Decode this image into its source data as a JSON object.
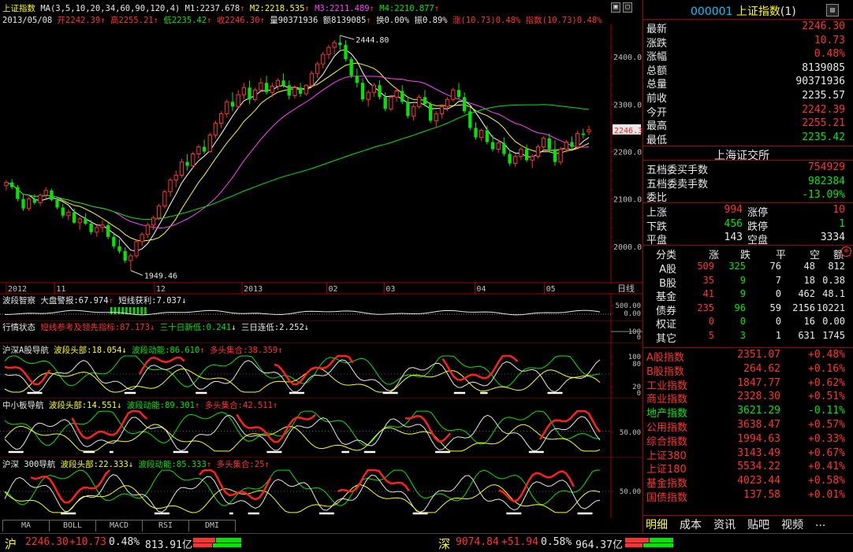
{
  "colors": {
    "up": "#ff3232",
    "down": "#00e600",
    "ma5": "#ffffff",
    "ma10": "#ffff00",
    "ma20": "#ff40ff",
    "ma60": "#00e600",
    "bg": "#000000",
    "grid": "#a00000"
  },
  "header": {
    "line1_name": "上证指数",
    "line1_ma": "MA(3,5,10,20,34,60,90,120,4)",
    "m1": "M1:2237.678",
    "m1_arrow": "↑",
    "m2": "M2:2218.535",
    "m2_arrow": "↑",
    "m3": "M3:2211.489",
    "m3_arrow": "↑",
    "m4": "M4:2210.877",
    "m4_arrow": "↑",
    "date": "2013/05/08",
    "open": "开2242.39",
    "open_arrow": "↑",
    "high": "高2255.21",
    "high_arrow": "↑",
    "low": "低2235.42",
    "low_arrow": "↑",
    "close": "收2246.30",
    "close_arrow": "↑",
    "volume": "量90371936",
    "amount": "额8139085",
    "amount_arrow": "↑",
    "turnover": "换0.00%",
    "amplitude": "振0.89%",
    "change": "涨(10.73)0.48%",
    "index_change": "指数(10.73)0.48%"
  },
  "right_panel": {
    "code": "000001",
    "name": "上证指数",
    "suffix": "(1)",
    "quote": [
      {
        "label": "最新",
        "value": "2246.30",
        "color": "r"
      },
      {
        "label": "涨跌",
        "value": "10.73",
        "color": "r"
      },
      {
        "label": "涨幅",
        "value": "0.48%",
        "color": "r"
      },
      {
        "label": "总额",
        "value": "8139085",
        "color": "w"
      },
      {
        "label": "总量",
        "value": "90371936",
        "color": "w"
      },
      {
        "label": "前收",
        "value": "2235.57",
        "color": "w"
      },
      {
        "label": "今开",
        "value": "2242.39",
        "color": "r"
      },
      {
        "label": "最高",
        "value": "2255.21",
        "color": "r"
      },
      {
        "label": "最低",
        "value": "2235.42",
        "color": "g"
      }
    ],
    "exchange": "上海证交所",
    "orders": [
      {
        "label": "五档委买手数",
        "value": "754929",
        "color": "r"
      },
      {
        "label": "五档委卖手数",
        "value": "982384",
        "color": "g"
      },
      {
        "label": "委比",
        "value": "-13.09%",
        "color": "g"
      }
    ],
    "breadth": [
      {
        "l1": "上涨",
        "v1": "994",
        "c1": "r",
        "l2": "涨停",
        "v2": "10",
        "c2": "r"
      },
      {
        "l1": "下跌",
        "v1": "456",
        "c1": "g",
        "l2": "跌停",
        "v2": "1",
        "c2": "g"
      },
      {
        "l1": "平盘",
        "v1": "143",
        "c1": "w",
        "l2": "空盘",
        "v2": "3334",
        "c2": "w"
      }
    ],
    "cat_header": [
      "分类",
      "涨",
      "跌",
      "平",
      "空",
      "额"
    ],
    "categories": [
      {
        "name": "A股",
        "up": "509",
        "down": "325",
        "flat": "76",
        "empty": "48",
        "amt": "812"
      },
      {
        "name": "B股",
        "up": "35",
        "down": "9",
        "flat": "7",
        "empty": "18",
        "amt": "0.38"
      },
      {
        "name": "基金",
        "up": "41",
        "down": "9",
        "flat": "0",
        "empty": "462",
        "amt": "48.1"
      },
      {
        "name": "债券",
        "up": "235",
        "down": "96",
        "flat": "59",
        "empty": "2156",
        "amt": "10221"
      },
      {
        "name": "权证",
        "up": "0",
        "down": "0",
        "flat": "0",
        "empty": "16",
        "amt": "0.00"
      },
      {
        "name": "其它",
        "up": "5",
        "down": "3",
        "flat": "1",
        "empty": "631",
        "amt": "1745"
      }
    ],
    "indices": [
      {
        "name": "A股指数",
        "value": "2351.07",
        "pct": "+0.48%",
        "color": "r"
      },
      {
        "name": "B股指数",
        "value": "264.62",
        "pct": "+0.16%",
        "color": "r"
      },
      {
        "name": "工业指数",
        "value": "1847.77",
        "pct": "+0.62%",
        "color": "r"
      },
      {
        "name": "商业指数",
        "value": "2328.30",
        "pct": "+0.51%",
        "color": "r"
      },
      {
        "name": "地产指数",
        "value": "3621.29",
        "pct": "-0.11%",
        "color": "g"
      },
      {
        "name": "公用指数",
        "value": "3638.47",
        "pct": "+0.57%",
        "color": "r"
      },
      {
        "name": "综合指数",
        "value": "1994.63",
        "pct": "+0.33%",
        "color": "r"
      },
      {
        "name": "上证380",
        "value": "3143.49",
        "pct": "+0.67%",
        "color": "r"
      },
      {
        "name": "上证180",
        "value": "5534.22",
        "pct": "+0.41%",
        "color": "r"
      },
      {
        "name": "基金指数",
        "value": "4023.44",
        "pct": "+0.58%",
        "color": "r"
      },
      {
        "name": "国债指数",
        "value": "137.58",
        "pct": "+0.01%",
        "color": "r"
      }
    ],
    "tabs": [
      "明细",
      "成本",
      "资讯",
      "贴吧",
      "视频",
      "..."
    ]
  },
  "indicator_tabs": [
    "MA",
    "BOLL",
    "MACD",
    "RSI",
    "DMI"
  ],
  "panels": {
    "p1": {
      "name": "波段智察",
      "a": "大盘警报:67.974",
      "a_arrow": "↑",
      "b": "短线获利:7.037",
      "b_arrow": "↓",
      "ticks": [
        "500.00",
        "0.00"
      ]
    },
    "p2": {
      "name": "行情状态",
      "a": "短线参考及领先指标:87.173",
      "a_arrow": "↓",
      "b": "三十日新低:0.241",
      "b_arrow": "↓",
      "c": "三日连低:2.252",
      "c_arrow": "↓",
      "ticks": [
        "100",
        "0"
      ]
    },
    "p3": {
      "name": "沪深A股导航",
      "a": "波段头部:18.054",
      "a_arrow": "↓",
      "b": "波段动能:86.610",
      "b_arrow": "↑",
      "c": "多头集合:38.359",
      "c_arrow": "↑",
      "ticks": [
        "100",
        "80",
        "20",
        "0"
      ]
    },
    "p4": {
      "name": "中小板导航",
      "a": "波段头部:14.551",
      "a_arrow": "↓",
      "b": "波段动能:89.301",
      "b_arrow": "↑",
      "c": "多头集合:42.511",
      "c_arrow": "↑",
      "ticks": [
        "50.00"
      ]
    },
    "p5": {
      "name": "沪深 300导航",
      "a": "波段头部:22.333",
      "a_arrow": "↓",
      "b": "波段动能:85.333",
      "b_arrow": "↑",
      "c": "多头集合:25",
      "c_arrow": "↑",
      "ticks": [
        "50.00"
      ]
    }
  },
  "time_axis": {
    "labels": [
      "2012",
      "11",
      "12",
      "2013",
      "02",
      "03",
      "04",
      "05"
    ],
    "unit": "日线"
  },
  "status_bar": {
    "sh_label": "沪",
    "sh_value": "2246.30",
    "sh_change": "+10.73",
    "sh_pct": "0.48%",
    "sh_amount": "813.91亿",
    "sz_label": "深",
    "sz_value": "9074.84",
    "sz_change": "+51.94",
    "sz_pct": "0.58%",
    "sz_amount": "964.37亿"
  },
  "chart_data": {
    "type": "candlestick",
    "title": "上证指数",
    "ylim": [
      1930,
      2470
    ],
    "ytick_labels": [
      "2400.0",
      "2300.0",
      "2200.0",
      "2100.0",
      "2000.0"
    ],
    "annotations": [
      {
        "text": "2444.80",
        "kind": "high"
      },
      {
        "text": "1949.46",
        "kind": "low"
      },
      {
        "text": "2246.30",
        "kind": "last"
      }
    ],
    "ma_legend": [
      "M1",
      "M2",
      "M3",
      "M4"
    ],
    "ohlc": [
      [
        2128,
        2140,
        2118,
        2135
      ],
      [
        2135,
        2142,
        2120,
        2125
      ],
      [
        2125,
        2130,
        2095,
        2100
      ],
      [
        2100,
        2110,
        2075,
        2080
      ],
      [
        2080,
        2105,
        2075,
        2100
      ],
      [
        2100,
        2110,
        2088,
        2092
      ],
      [
        2092,
        2112,
        2085,
        2108
      ],
      [
        2108,
        2125,
        2100,
        2118
      ],
      [
        2118,
        2122,
        2095,
        2098
      ],
      [
        2098,
        2104,
        2078,
        2082
      ],
      [
        2082,
        2090,
        2060,
        2065
      ],
      [
        2065,
        2078,
        2055,
        2072
      ],
      [
        2072,
        2080,
        2048,
        2050
      ],
      [
        2050,
        2062,
        2035,
        2058
      ],
      [
        2058,
        2070,
        2045,
        2048
      ],
      [
        2048,
        2055,
        2025,
        2030
      ],
      [
        2030,
        2045,
        2020,
        2040
      ],
      [
        2040,
        2055,
        2030,
        2045
      ],
      [
        2045,
        2050,
        2015,
        2020
      ],
      [
        2020,
        2030,
        1995,
        2000
      ],
      [
        2000,
        2015,
        1985,
        1990
      ],
      [
        1990,
        1998,
        1965,
        1970
      ],
      [
        1970,
        1985,
        1949,
        1980
      ],
      [
        1980,
        2015,
        1975,
        2010
      ],
      [
        2010,
        2030,
        2000,
        2025
      ],
      [
        2025,
        2050,
        2018,
        2045
      ],
      [
        2045,
        2065,
        2035,
        2060
      ],
      [
        2060,
        2090,
        2055,
        2085
      ],
      [
        2085,
        2120,
        2080,
        2115
      ],
      [
        2115,
        2145,
        2105,
        2140
      ],
      [
        2140,
        2160,
        2125,
        2150
      ],
      [
        2150,
        2185,
        2145,
        2178
      ],
      [
        2178,
        2195,
        2160,
        2170
      ],
      [
        2170,
        2200,
        2165,
        2195
      ],
      [
        2195,
        2215,
        2185,
        2210
      ],
      [
        2210,
        2225,
        2195,
        2200
      ],
      [
        2200,
        2240,
        2198,
        2235
      ],
      [
        2235,
        2265,
        2228,
        2260
      ],
      [
        2260,
        2285,
        2250,
        2280
      ],
      [
        2280,
        2310,
        2272,
        2305
      ],
      [
        2305,
        2325,
        2285,
        2295
      ],
      [
        2295,
        2330,
        2290,
        2320
      ],
      [
        2320,
        2345,
        2310,
        2335
      ],
      [
        2335,
        2350,
        2300,
        2310
      ],
      [
        2310,
        2335,
        2305,
        2330
      ],
      [
        2330,
        2355,
        2325,
        2345
      ],
      [
        2345,
        2360,
        2320,
        2325
      ],
      [
        2325,
        2345,
        2315,
        2338
      ],
      [
        2338,
        2355,
        2330,
        2350
      ],
      [
        2350,
        2365,
        2335,
        2340
      ],
      [
        2340,
        2350,
        2310,
        2318
      ],
      [
        2318,
        2340,
        2312,
        2335
      ],
      [
        2335,
        2345,
        2315,
        2322
      ],
      [
        2322,
        2342,
        2318,
        2340
      ],
      [
        2340,
        2370,
        2335,
        2365
      ],
      [
        2365,
        2390,
        2355,
        2385
      ],
      [
        2385,
        2410,
        2375,
        2405
      ],
      [
        2405,
        2425,
        2395,
        2420
      ],
      [
        2420,
        2435,
        2405,
        2430
      ],
      [
        2430,
        2445,
        2415,
        2425
      ],
      [
        2425,
        2435,
        2390,
        2395
      ],
      [
        2395,
        2400,
        2355,
        2360
      ],
      [
        2360,
        2375,
        2335,
        2345
      ],
      [
        2345,
        2355,
        2305,
        2310
      ],
      [
        2310,
        2330,
        2295,
        2325
      ],
      [
        2325,
        2345,
        2315,
        2340
      ],
      [
        2340,
        2350,
        2310,
        2315
      ],
      [
        2315,
        2325,
        2285,
        2290
      ],
      [
        2290,
        2320,
        2285,
        2315
      ],
      [
        2315,
        2335,
        2305,
        2328
      ],
      [
        2328,
        2340,
        2300,
        2305
      ],
      [
        2305,
        2315,
        2270,
        2275
      ],
      [
        2275,
        2300,
        2265,
        2295
      ],
      [
        2295,
        2320,
        2290,
        2315
      ],
      [
        2315,
        2330,
        2295,
        2300
      ],
      [
        2300,
        2305,
        2260,
        2265
      ],
      [
        2265,
        2285,
        2250,
        2280
      ],
      [
        2280,
        2300,
        2270,
        2295
      ],
      [
        2295,
        2315,
        2285,
        2310
      ],
      [
        2310,
        2335,
        2305,
        2330
      ],
      [
        2330,
        2345,
        2310,
        2315
      ],
      [
        2315,
        2325,
        2280,
        2285
      ],
      [
        2285,
        2295,
        2245,
        2250
      ],
      [
        2250,
        2262,
        2225,
        2230
      ],
      [
        2230,
        2248,
        2222,
        2245
      ],
      [
        2245,
        2255,
        2215,
        2220
      ],
      [
        2220,
        2235,
        2200,
        2205
      ],
      [
        2205,
        2225,
        2198,
        2218
      ],
      [
        2218,
        2230,
        2190,
        2195
      ],
      [
        2195,
        2205,
        2170,
        2175
      ],
      [
        2175,
        2195,
        2168,
        2190
      ],
      [
        2190,
        2210,
        2182,
        2205
      ],
      [
        2205,
        2215,
        2178,
        2182
      ],
      [
        2182,
        2195,
        2165,
        2190
      ],
      [
        2190,
        2215,
        2185,
        2210
      ],
      [
        2210,
        2232,
        2205,
        2228
      ],
      [
        2228,
        2238,
        2200,
        2205
      ],
      [
        2205,
        2225,
        2170,
        2178
      ],
      [
        2178,
        2210,
        2172,
        2205
      ],
      [
        2205,
        2225,
        2198,
        2220
      ],
      [
        2220,
        2232,
        2205,
        2210
      ],
      [
        2210,
        2245,
        2208,
        2238
      ],
      [
        2238,
        2248,
        2228,
        2235
      ],
      [
        2242,
        2255,
        2235,
        2246
      ]
    ]
  }
}
